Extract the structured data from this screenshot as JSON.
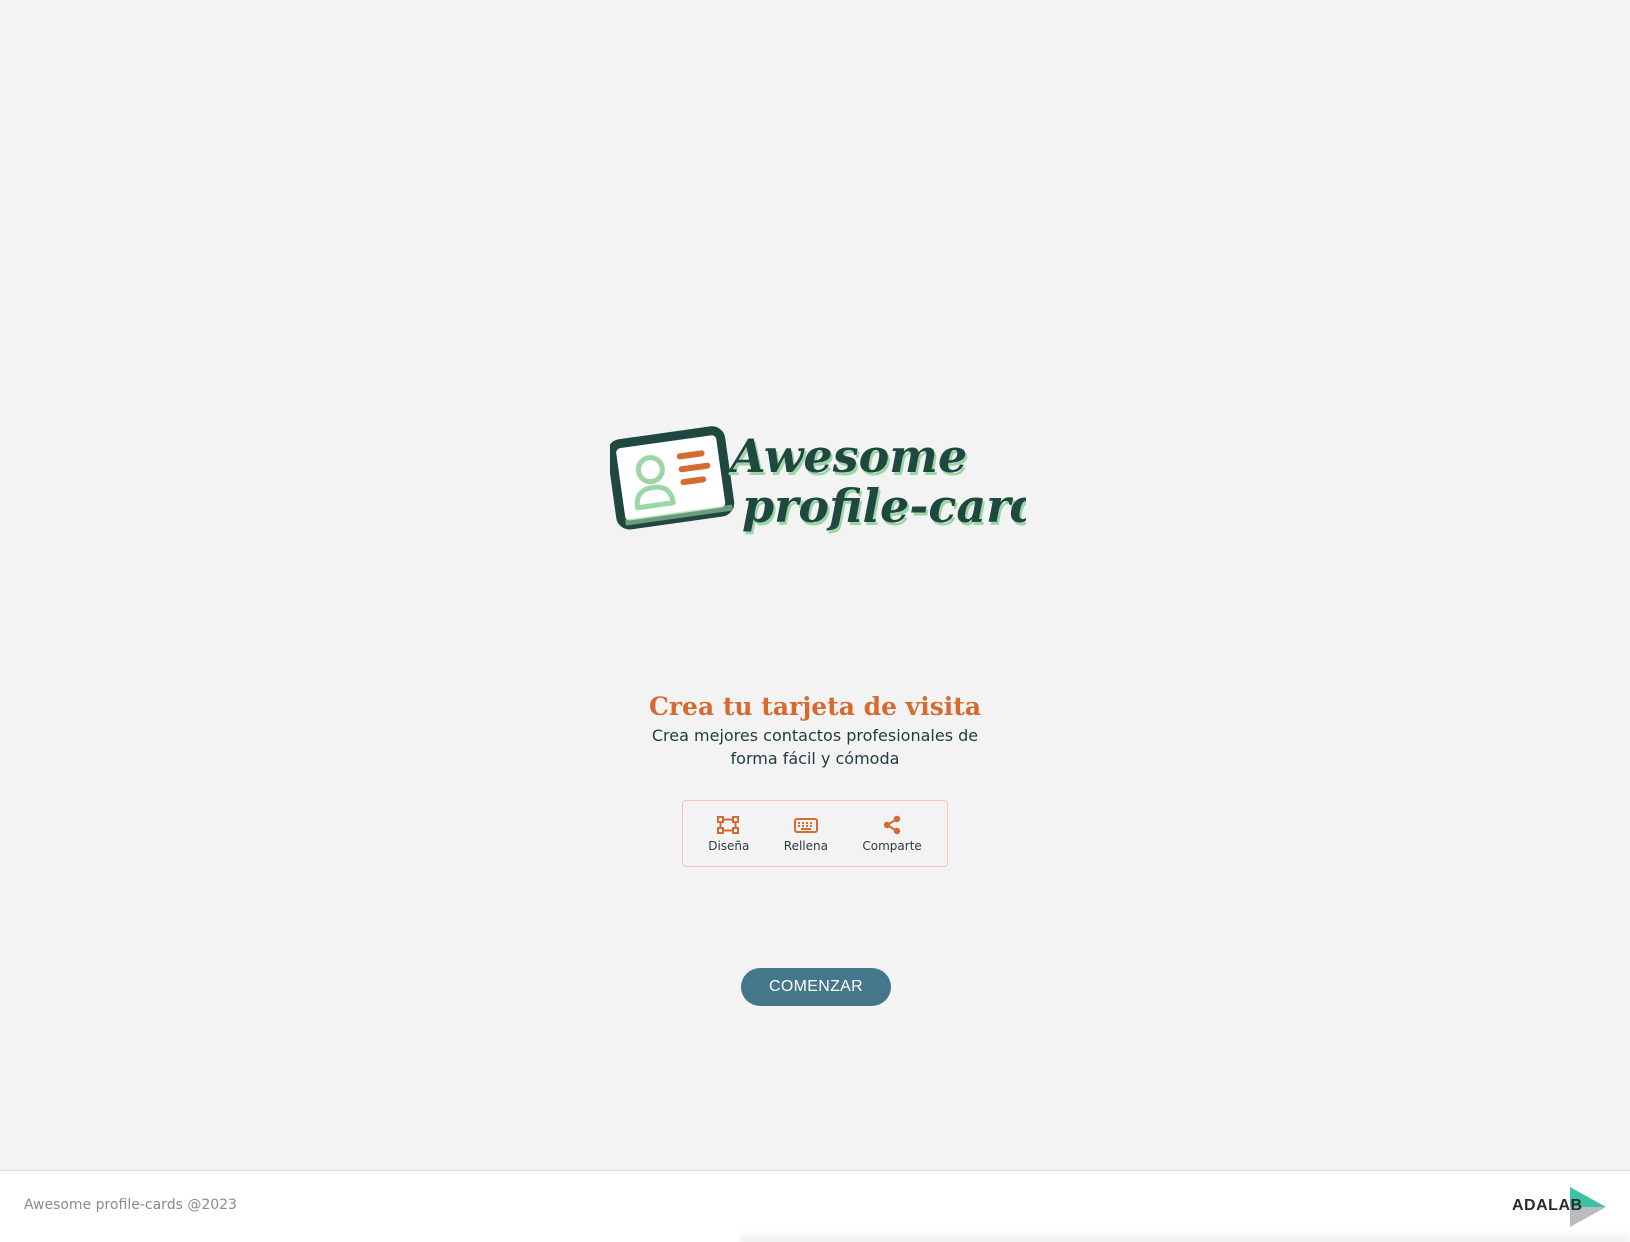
{
  "brand": {
    "logo_line1": "Awesome",
    "logo_line2": "profile-cards",
    "colors": {
      "dark_green": "#1f4840",
      "light_green": "#9bd6a5",
      "orange": "#d56b33",
      "button": "#44778a",
      "background": "#f3f3f3"
    }
  },
  "hero": {
    "title": "Crea tu tarjeta de visita",
    "subtitle_line1": "Crea mejores contactos profesionales de",
    "subtitle_line2": "forma fácil y cómoda"
  },
  "steps": [
    {
      "icon": "design-icon",
      "label": "Diseña"
    },
    {
      "icon": "keyboard-icon",
      "label": "Rellena"
    },
    {
      "icon": "share-icon",
      "label": "Comparte"
    }
  ],
  "start_button": {
    "label": "COMENZAR"
  },
  "footer": {
    "copyright": "Awesome profile-cards @2023",
    "partner_logo_text": "ADALAB"
  }
}
